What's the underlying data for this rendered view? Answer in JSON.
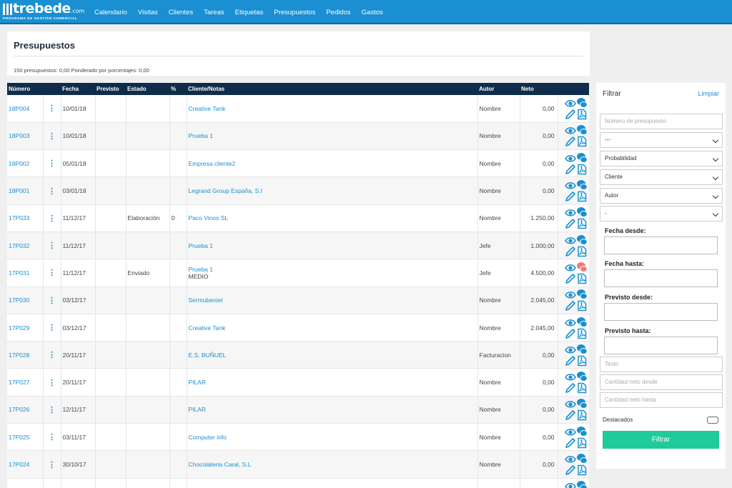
{
  "brand": {
    "name": "trebede",
    "suffix": ".com",
    "tagline": "PROGRAMA DE GESTIÓN COMERCIAL"
  },
  "nav": [
    "Calendario",
    "Visitas",
    "Clientes",
    "Tareas",
    "Etiquetas",
    "Presupuestos",
    "Pedidos",
    "Gastos"
  ],
  "page": {
    "title": "Presupuestos",
    "summary": "150 presupuestos: 0,00 Ponderado por porcentajes: 0,00"
  },
  "table": {
    "columns": [
      "Número",
      "",
      "Fecha",
      "Previsto",
      "Estado",
      "%",
      "Cliente/Notas",
      "Autor",
      "Neto",
      ""
    ],
    "rows": [
      {
        "numero": "18P004",
        "fecha": "10/01/18",
        "previsto": "",
        "estado": "",
        "pct": "",
        "cliente": "Creative Tank",
        "nota": "",
        "autor": "Nombre",
        "neto": "0,00",
        "chat": "blue"
      },
      {
        "numero": "18P003",
        "fecha": "10/01/18",
        "previsto": "",
        "estado": "",
        "pct": "",
        "cliente": "Prueba 1",
        "nota": "",
        "autor": "Nombre",
        "neto": "0,00",
        "chat": "blue"
      },
      {
        "numero": "18P002",
        "fecha": "05/01/18",
        "previsto": "",
        "estado": "",
        "pct": "",
        "cliente": "Empresa cliente2",
        "nota": "",
        "autor": "Nombre",
        "neto": "0,00",
        "chat": "blue"
      },
      {
        "numero": "18P001",
        "fecha": "03/01/18",
        "previsto": "",
        "estado": "",
        "pct": "",
        "cliente": "Legrand Group España, S.I",
        "nota": "",
        "autor": "Nombre",
        "neto": "0,00",
        "chat": "blue"
      },
      {
        "numero": "17P033",
        "fecha": "11/12/17",
        "previsto": "",
        "estado": "Elaboración",
        "pct": "0",
        "cliente": "Paco Vinos SL",
        "nota": "",
        "autor": "Nombre",
        "neto": "1.250,00",
        "chat": "blue"
      },
      {
        "numero": "17P032",
        "fecha": "11/12/17",
        "previsto": "",
        "estado": "",
        "pct": "",
        "cliente": "Prueba 1",
        "nota": "",
        "autor": "Jefe",
        "neto": "1.000,00",
        "chat": "blue"
      },
      {
        "numero": "17P031",
        "fecha": "11/12/17",
        "previsto": "",
        "estado": "Enviado",
        "pct": "",
        "cliente": "Prueba 1",
        "nota": "MEDIO",
        "autor": "Jefe",
        "neto": "4.500,00",
        "chat": "red"
      },
      {
        "numero": "17P030",
        "fecha": "03/12/17",
        "previsto": "",
        "estado": "",
        "pct": "",
        "cliente": "Sermubeniel",
        "nota": "",
        "autor": "Nombre",
        "neto": "2.045,00",
        "chat": "blue"
      },
      {
        "numero": "17P029",
        "fecha": "03/12/17",
        "previsto": "",
        "estado": "",
        "pct": "",
        "cliente": "Creative Tank",
        "nota": "",
        "autor": "Nombre",
        "neto": "2.045,00",
        "chat": "blue"
      },
      {
        "numero": "17P028",
        "fecha": "20/11/17",
        "previsto": "",
        "estado": "",
        "pct": "",
        "cliente": "E.S. BUÑUEL",
        "nota": "",
        "autor": "Facturacion",
        "neto": "0,00",
        "chat": "blue"
      },
      {
        "numero": "17P027",
        "fecha": "20/11/17",
        "previsto": "",
        "estado": "",
        "pct": "",
        "cliente": "PILAR",
        "nota": "",
        "autor": "Nombre",
        "neto": "0,00",
        "chat": "blue"
      },
      {
        "numero": "17P026",
        "fecha": "12/11/17",
        "previsto": "",
        "estado": "",
        "pct": "",
        "cliente": "PILAR",
        "nota": "",
        "autor": "Nombre",
        "neto": "0,00",
        "chat": "blue"
      },
      {
        "numero": "17P025",
        "fecha": "03/11/17",
        "previsto": "",
        "estado": "",
        "pct": "",
        "cliente": "Computer info",
        "nota": "",
        "autor": "Nombre",
        "neto": "0,00",
        "chat": "blue"
      },
      {
        "numero": "17P024",
        "fecha": "30/10/17",
        "previsto": "",
        "estado": "",
        "pct": "",
        "cliente": "Chocolateria Caral, S.L",
        "nota": "",
        "autor": "Nombre",
        "neto": "0,00",
        "chat": "blue"
      },
      {
        "numero": "",
        "fecha": "",
        "previsto": "",
        "estado": "",
        "pct": "",
        "cliente": "",
        "nota": "",
        "autor": "",
        "neto": "",
        "chat": "blue"
      }
    ]
  },
  "filter": {
    "title": "Filtrar",
    "clear": "Limpiar",
    "numero_placeholder": "Número de presupuesto",
    "selects": [
      "---",
      "Probabilidad",
      "Cliente",
      "Autor",
      "-"
    ],
    "fecha_desde": "Fecha desde:",
    "fecha_hasta": "Fecha hasta:",
    "previsto_desde": "Previsto desde:",
    "previsto_hasta": "Previsto hasta:",
    "texto_placeholder": "Texto",
    "neto_desde_placeholder": "Cantidad neto desde",
    "neto_hasta_placeholder": "Cantidad neto hasta",
    "destacados": "Destacados",
    "button": "Filtrar"
  },
  "colors": {
    "accent": "#1a8fd1",
    "header": "#0f2d4a",
    "button": "#1fcb9a",
    "chat_alert": "#f07b7b"
  },
  "icons": [
    "eye-icon",
    "chat-icon",
    "edit-pencil-icon",
    "pdf-icon",
    "kebab-menu-icon",
    "chevron-down-icon"
  ]
}
